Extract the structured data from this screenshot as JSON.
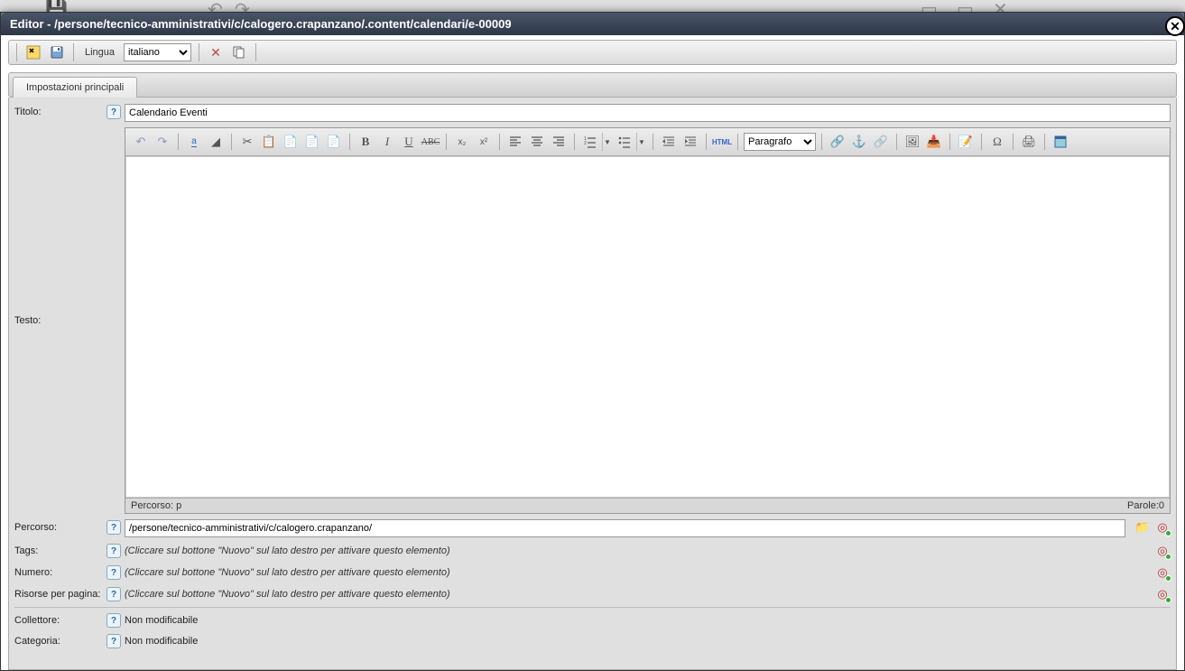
{
  "bg_icons": [
    "💾",
    "↶",
    "↷",
    "🔍",
    "⊙"
  ],
  "window": {
    "title": "Editor - /persone/tecnico-amministrativi/c/calogero.crapanzano/.content/calendari/e-00009"
  },
  "toolbar": {
    "lang_label": "Lingua",
    "lang_value": "italiano",
    "lang_options": [
      "italiano"
    ]
  },
  "tabs": {
    "main": "Impostazioni principali"
  },
  "fields": {
    "titolo": {
      "label": "Titolo:",
      "value": "Calendario Eventi"
    },
    "testo": {
      "label": "Testo:"
    },
    "percorso": {
      "label": "Percorso:",
      "value": "/persone/tecnico-amministrativi/c/calogero.crapanzano/"
    },
    "tags": {
      "label": "Tags:",
      "hint": "(Cliccare sul bottone \"Nuovo\" sul lato destro per attivare questo elemento)"
    },
    "numero": {
      "label": "Numero:",
      "hint": "(Cliccare sul bottone \"Nuovo\" sul lato destro per attivare questo elemento)"
    },
    "risorse": {
      "label": "Risorse per pagina:",
      "hint": "(Cliccare sul bottone \"Nuovo\" sul lato destro per attivare questo elemento)"
    },
    "collettore": {
      "label": "Collettore:",
      "value": "Non modificabile"
    },
    "categoria": {
      "label": "Categoria:",
      "value": "Non modificabile"
    }
  },
  "rte": {
    "format_value": "Paragrafo",
    "path_label": "Percorso: p",
    "words_label": "Parole:0"
  }
}
